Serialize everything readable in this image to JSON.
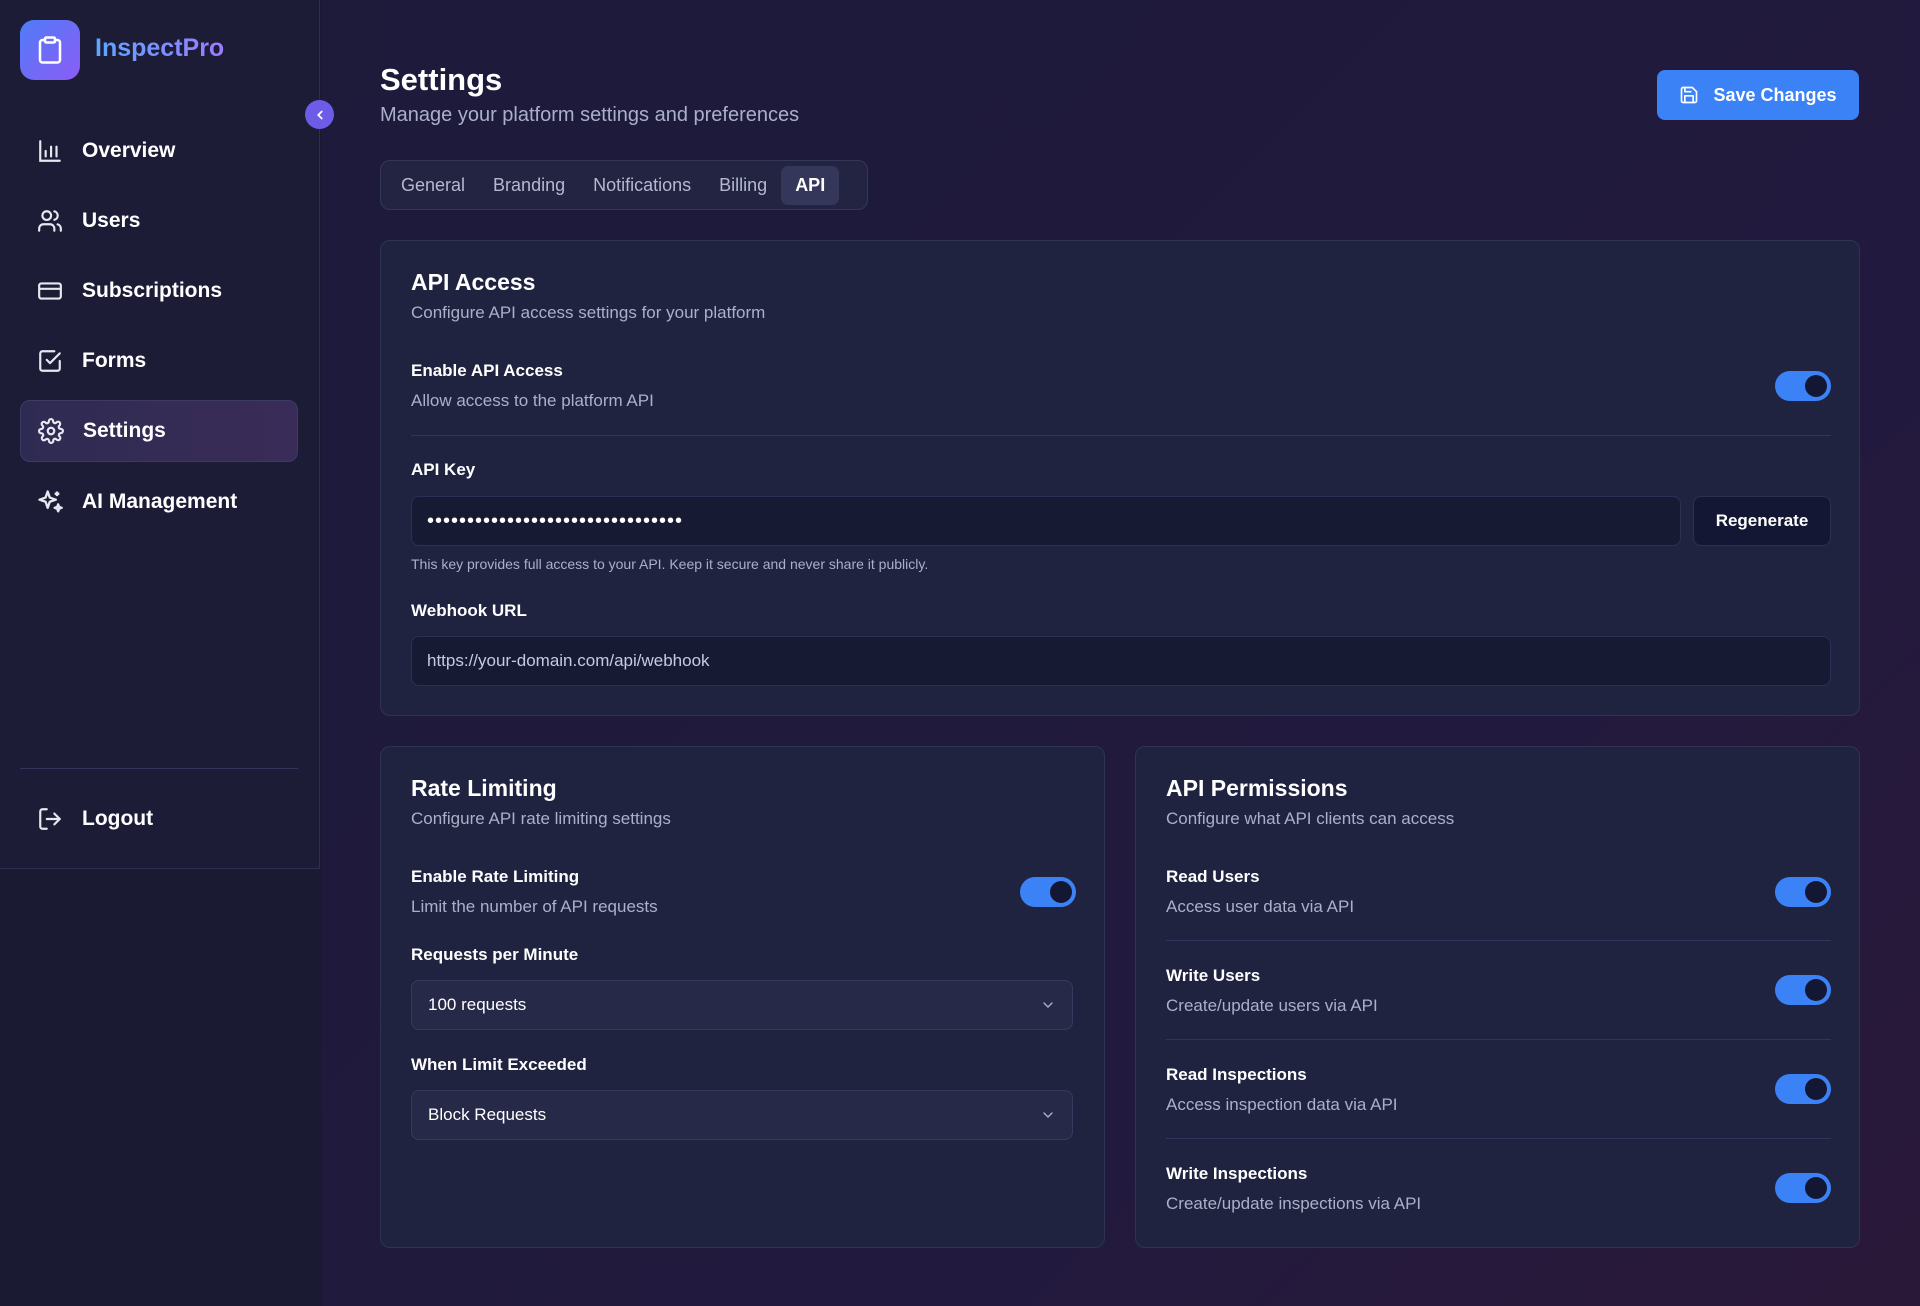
{
  "app": {
    "name": "InspectPro"
  },
  "sidebar": {
    "items": [
      {
        "label": "Overview",
        "icon": "bar-chart-icon"
      },
      {
        "label": "Users",
        "icon": "users-icon"
      },
      {
        "label": "Subscriptions",
        "icon": "credit-card-icon"
      },
      {
        "label": "Forms",
        "icon": "checkbox-icon"
      },
      {
        "label": "Settings",
        "icon": "gear-icon",
        "active": true
      },
      {
        "label": "AI Management",
        "icon": "sparkles-icon"
      }
    ],
    "logout_label": "Logout"
  },
  "header": {
    "title": "Settings",
    "subtitle": "Manage your platform settings and preferences",
    "save_label": "Save Changes"
  },
  "tabs": [
    {
      "label": "General"
    },
    {
      "label": "Branding"
    },
    {
      "label": "Notifications"
    },
    {
      "label": "Billing"
    },
    {
      "label": "API",
      "active": true
    }
  ],
  "api_access": {
    "title": "API Access",
    "subtitle": "Configure API access settings for your platform",
    "enable_label": "Enable API Access",
    "enable_sub": "Allow access to the platform API",
    "enabled": true,
    "key_label": "API Key",
    "key_value": "••••••••••••••••••••••••••••••••",
    "regenerate_label": "Regenerate",
    "key_hint": "This key provides full access to your API. Keep it secure and never share it publicly.",
    "webhook_label": "Webhook URL",
    "webhook_placeholder": "https://your-domain.com/api/webhook"
  },
  "rate_limiting": {
    "title": "Rate Limiting",
    "subtitle": "Configure API rate limiting settings",
    "enable_label": "Enable Rate Limiting",
    "enable_sub": "Limit the number of API requests",
    "enabled": true,
    "rpm_label": "Requests per Minute",
    "rpm_value": "100 requests",
    "exceeded_label": "When Limit Exceeded",
    "exceeded_value": "Block Requests"
  },
  "permissions": {
    "title": "API Permissions",
    "subtitle": "Configure what API clients can access",
    "items": [
      {
        "label": "Read Users",
        "sub": "Access user data via API",
        "enabled": true
      },
      {
        "label": "Write Users",
        "sub": "Create/update users via API",
        "enabled": true
      },
      {
        "label": "Read Inspections",
        "sub": "Access inspection data via API",
        "enabled": true
      },
      {
        "label": "Write Inspections",
        "sub": "Create/update inspections via API",
        "enabled": true
      }
    ]
  },
  "colors": {
    "accent": "#3b82f6",
    "active_nav": "#34305a",
    "background": "#1f1b3c"
  }
}
